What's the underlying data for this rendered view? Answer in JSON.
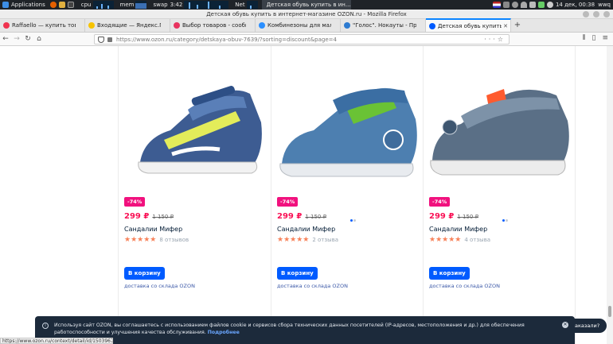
{
  "taskbar": {
    "applications": "Applications",
    "cpu": "cpu",
    "mem": "mem",
    "swap": "swap",
    "time": "3:42",
    "net": "Net",
    "window_task": "Детская обувь купить в ин...",
    "lang": "wwq",
    "clock": "14 дек, 00:38"
  },
  "window": {
    "title": "Детская обувь купить в интернет-магазине OZON.ru - Mozilla Firefox"
  },
  "tabs": [
    {
      "label": "Raffaello — купить товары б",
      "color": "#f0334f"
    },
    {
      "label": "Входящие — Яндекс.Почта",
      "color": "#f7c300"
    },
    {
      "label": "Выбор товаров - сообщест",
      "color": "#e8335f"
    },
    {
      "label": "Комбинезоны для мальчи",
      "color": "#2b8fff"
    },
    {
      "label": "\"Голос\". Нокауты - Прямой",
      "color": "#2d7bd1"
    },
    {
      "label": "Детская обувь купить в инт",
      "color": "#005bff"
    }
  ],
  "url": {
    "value": "https://www.ozon.ru/category/detskaya-obuv-7639/?sorting=discount&page=4"
  },
  "products": [
    {
      "discount": "-74%",
      "price": "299 ₽",
      "old_price": "1 150 ₽",
      "name": "Сандалии Мифер",
      "rating": 5,
      "reviews": "8 отзывов",
      "cart": "В корзину",
      "delivery": "доставка со склада OZON"
    },
    {
      "discount": "-74%",
      "price": "299 ₽",
      "old_price": "1 150 ₽",
      "name": "Сандалии Мифер",
      "rating": 4.5,
      "reviews": "2 отзыва",
      "cart": "В корзину",
      "delivery": "доставка со склада OZON"
    },
    {
      "discount": "-74%",
      "price": "299 ₽",
      "old_price": "1 150 ₽",
      "name": "Сандалии Мифер",
      "rating": 4.5,
      "reviews": "4 отзыва",
      "cart": "В корзину",
      "delivery": "доставка со склада OZON"
    }
  ],
  "consent": {
    "text": "Используя сайт OZON, вы соглашаетесь с использованием файлов cookie и сервисов сбора технических данных посетителей (IP-адресов, местоположения и др.) для обеспечения работоспособности и улучшения качества обслуживания.",
    "more": "Подробнее"
  },
  "help_bubble": "аказали?",
  "status_url": "https://www.ozon.ru/context/detail/id/150396737/",
  "colors": {
    "accent": "#005bff",
    "sale": "#f1117e",
    "price": "#f91155"
  }
}
